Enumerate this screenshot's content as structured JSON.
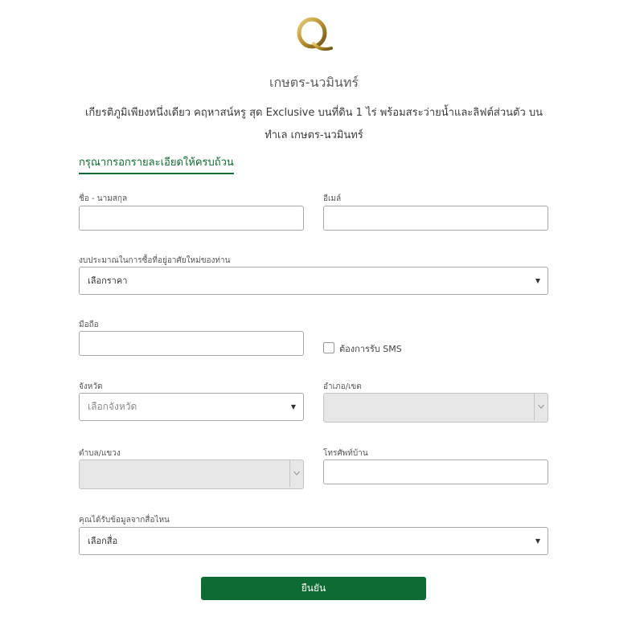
{
  "header": {
    "logo_letter": "Q",
    "project_title": "เกษตร-นวมินทร์",
    "tagline": "เกียรติภูมิเพียงหนึ่งเดียว คฤหาสน์หรู สุด Exclusive บนที่ดิน 1 ไร่ พร้อมสระว่ายน้ำและลิฟต์ส่วนตัว บนทำเล เกษตร-นวมินทร์",
    "instruction": "กรุณากรอกรายละเอียดให้ครบถ้วน"
  },
  "form": {
    "name_label": "ชื่อ - นามสกุล",
    "email_label": "อีเมล์",
    "budget_label": "งบประมาณในการซื้อที่อยู่อาศัยใหม่ของท่าน",
    "budget_value": "เลือกราคา",
    "mobile_label": "มือถือ",
    "sms_label": "ต้องการรับ SMS",
    "province_label": "จังหวัด",
    "province_value": "เลือกจังหวัด",
    "district_label": "อำเภอ/เขต",
    "subdistrict_label": "ตำบล/แขวง",
    "phone_label": "โทรศัพท์บ้าน",
    "source_label": "คุณได้รับข้อมูลจากสื่อไหน",
    "source_value": "เลือกสื่อ",
    "submit_label": "ยืนยัน"
  },
  "colors": {
    "accent": "#0e6b33",
    "logo_gold": "#b8912b"
  },
  "icons": {
    "dropdown": "caret-down-icon",
    "disabled_dropdown": "chevron-down-icon"
  }
}
